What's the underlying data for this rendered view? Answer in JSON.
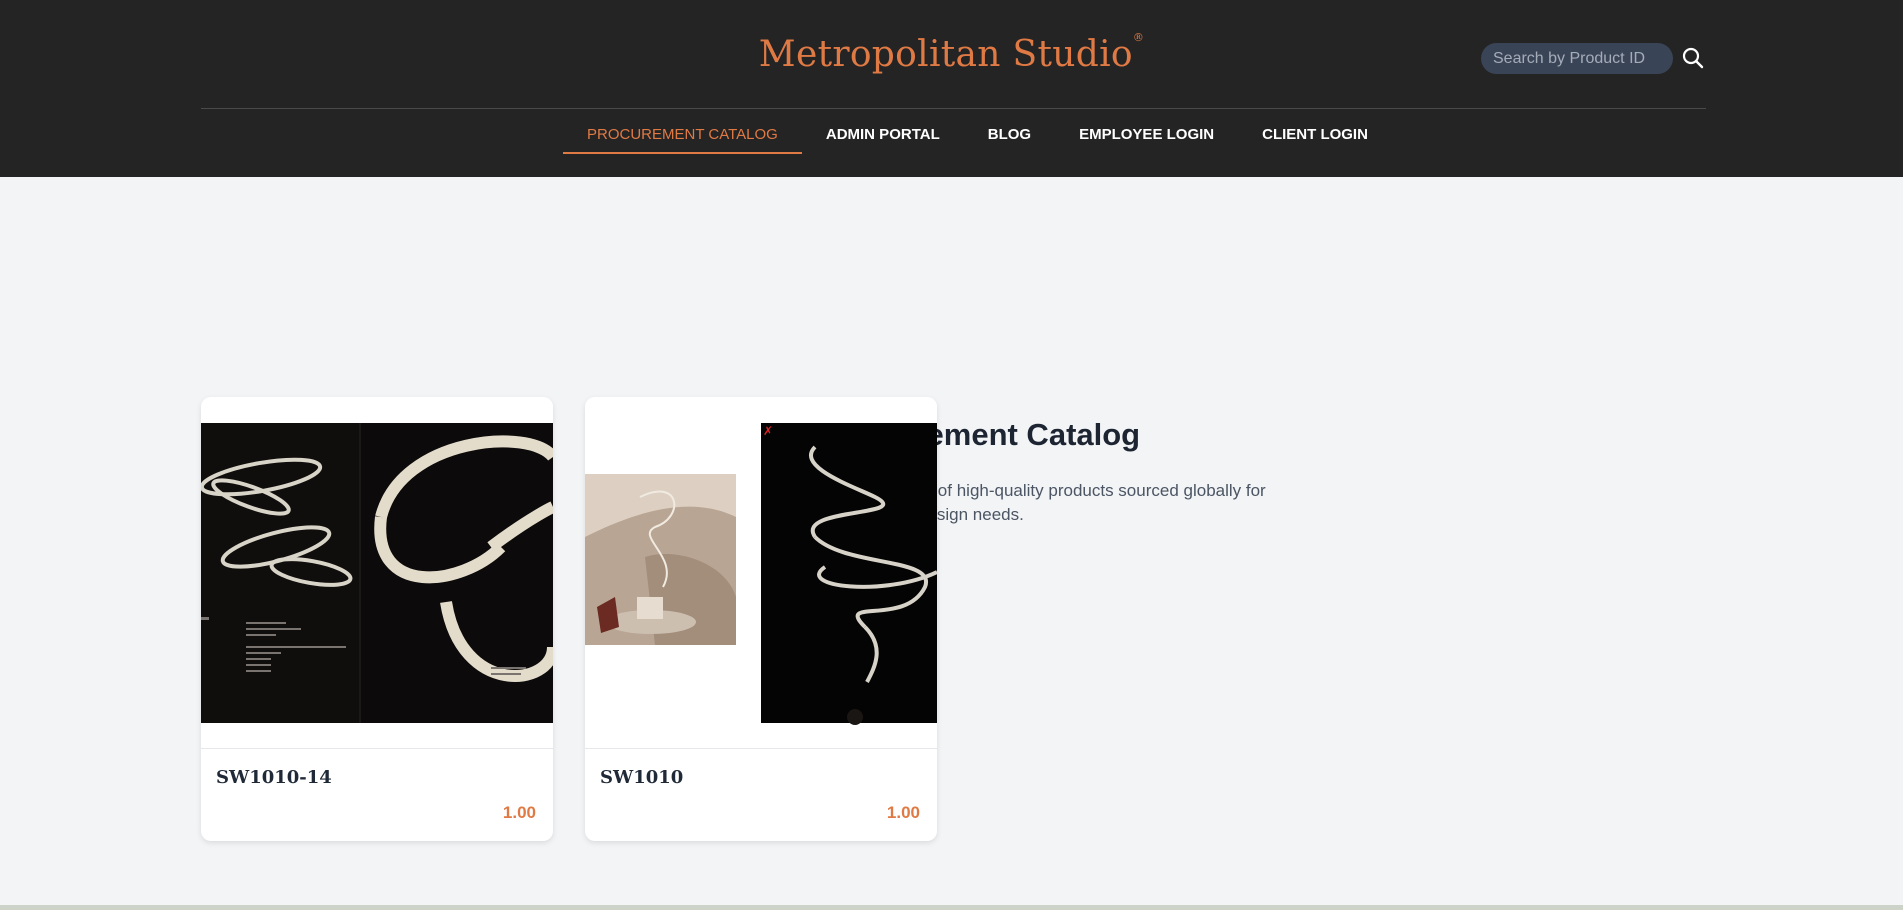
{
  "header": {
    "brand": "Metropolitan Studio",
    "brand_mark": "®",
    "search_placeholder": "Search by Product ID",
    "search_icon": "search-icon"
  },
  "nav": {
    "items": [
      {
        "label": "PROCUREMENT CATALOG",
        "active": true
      },
      {
        "label": "ADMIN PORTAL",
        "active": false
      },
      {
        "label": "BLOG",
        "active": false
      },
      {
        "label": "EMPLOYEE LOGIN",
        "active": false
      },
      {
        "label": "CLIENT LOGIN",
        "active": false
      }
    ]
  },
  "main": {
    "title": "Our Procurement Catalog",
    "subtitle": "Browse through our exclusive selection of high-quality products sourced globally for your design needs."
  },
  "products": [
    {
      "name": "SW1010-14",
      "price": "1.00"
    },
    {
      "name": "SW1010",
      "price": "1.00"
    }
  ],
  "colors": {
    "accent": "#e07a45",
    "header_bg": "#242424",
    "page_bg": "#f2f4f6"
  }
}
